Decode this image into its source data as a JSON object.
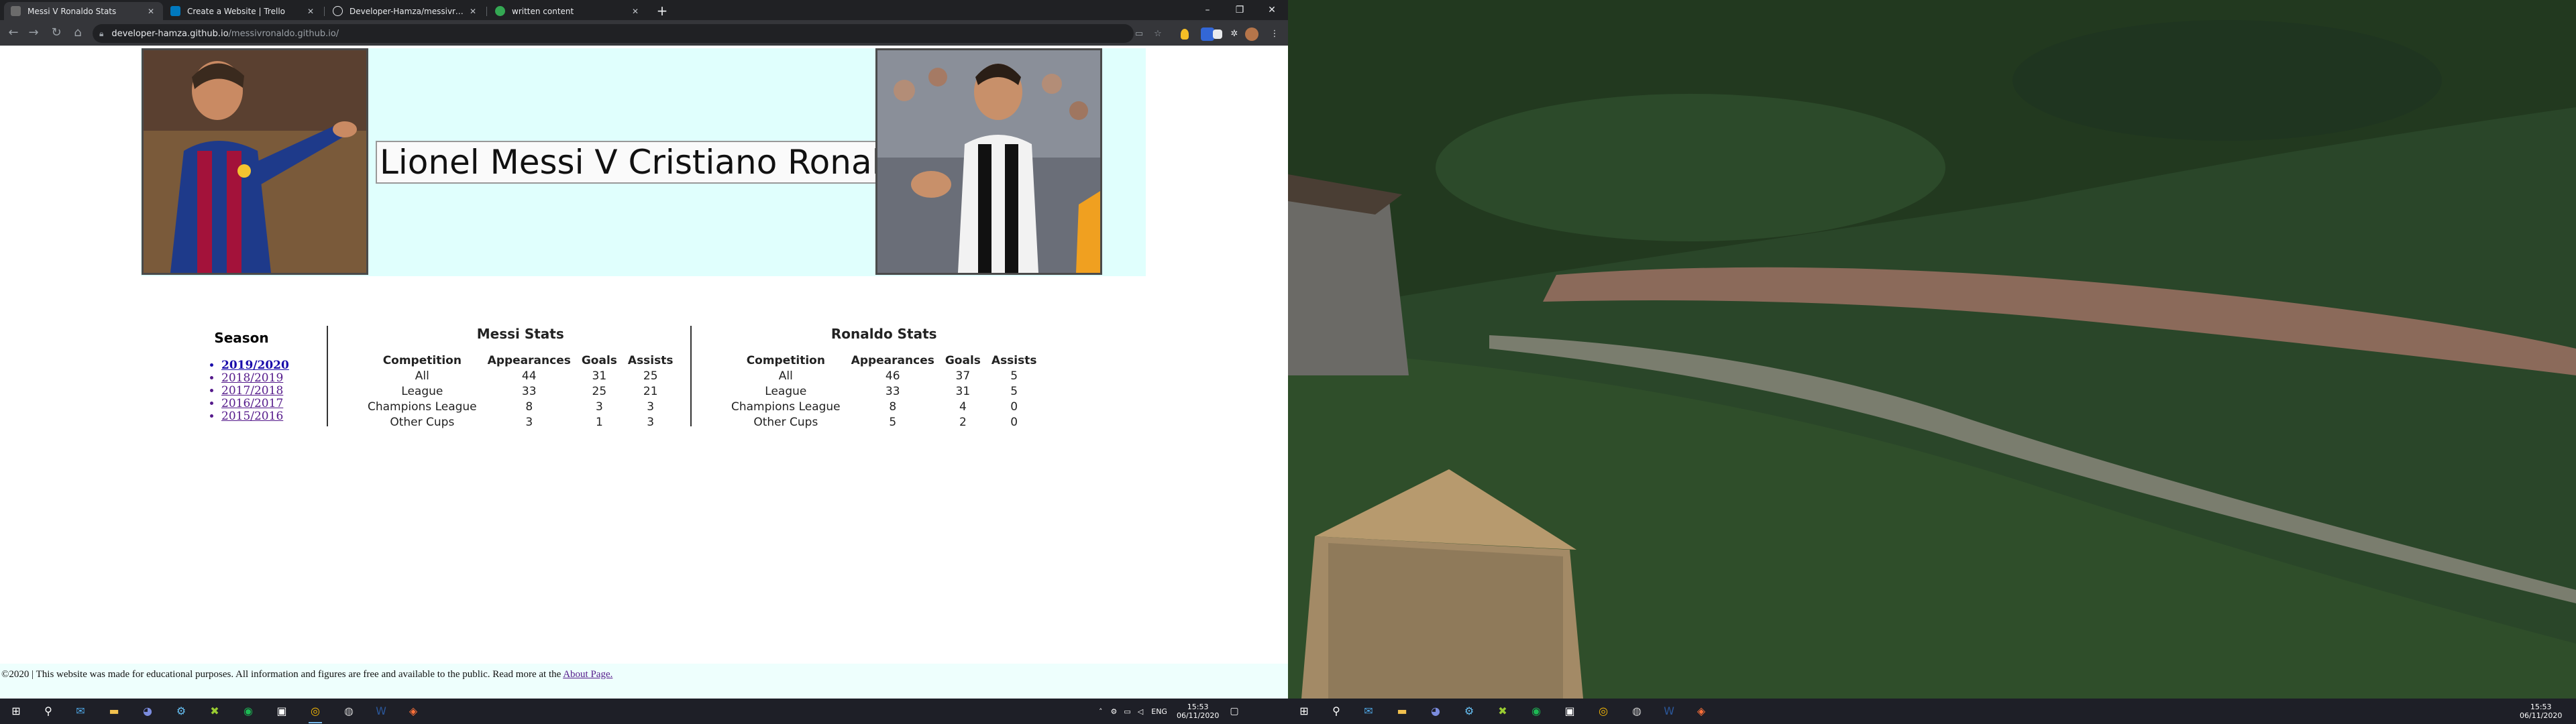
{
  "browser": {
    "tabs": [
      {
        "label": "Messi V Ronaldo Stats",
        "active": true,
        "favicon_color": "#6b6b6b"
      },
      {
        "label": "Create a Website | Trello",
        "active": false,
        "favicon_color": "#0079bf"
      },
      {
        "label": "Developer-Hamza/messivronaldo",
        "active": false,
        "favicon_color": "#e8eaed"
      },
      {
        "label": "written content",
        "active": false,
        "favicon_color": "#34a853"
      }
    ],
    "url_host": "developer-hamza.github.io",
    "url_path": "/messivronaldo.github.io/"
  },
  "page": {
    "title": "Lionel Messi V Cristiano Ronaldo",
    "season": {
      "heading": "Season",
      "items": [
        "2019/2020",
        "2018/2019",
        "2017/2018",
        "2016/2017",
        "2015/2016"
      ],
      "selected": "2019/2020"
    },
    "messi": {
      "heading": "Messi Stats",
      "columns": [
        "Competition",
        "Appearances",
        "Goals",
        "Assists"
      ],
      "rows": [
        [
          "All",
          "44",
          "31",
          "25"
        ],
        [
          "League",
          "33",
          "25",
          "21"
        ],
        [
          "Champions League",
          "8",
          "3",
          "3"
        ],
        [
          "Other Cups",
          "3",
          "1",
          "3"
        ]
      ]
    },
    "ronaldo": {
      "heading": "Ronaldo Stats",
      "columns": [
        "Competition",
        "Appearances",
        "Goals",
        "Assists"
      ],
      "rows": [
        [
          "All",
          "46",
          "37",
          "5"
        ],
        [
          "League",
          "33",
          "31",
          "5"
        ],
        [
          "Champions League",
          "8",
          "4",
          "0"
        ],
        [
          "Other Cups",
          "5",
          "2",
          "0"
        ]
      ]
    },
    "footer": {
      "text": "©2020 | This website was made for educational purposes. All information and figures are free and available to the public. Read more at the",
      "link": "About Page."
    }
  },
  "taskbar": {
    "language": "ENG",
    "time": "15:53",
    "date": "06/11/2020"
  }
}
